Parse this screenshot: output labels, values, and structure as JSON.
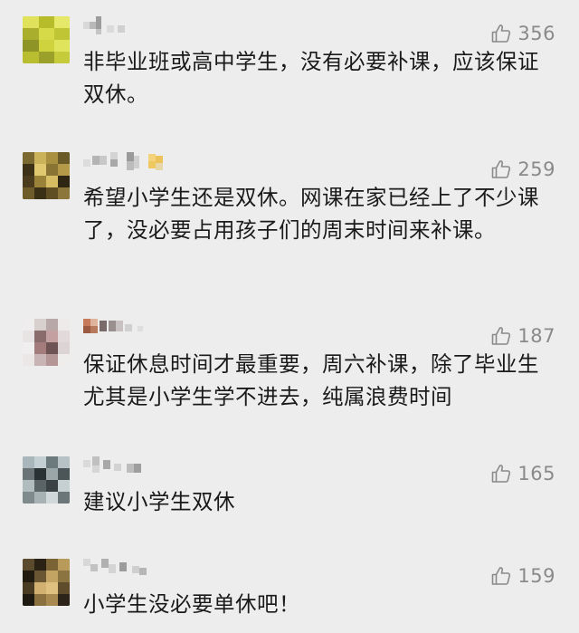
{
  "comments": [
    {
      "likes": "356",
      "text": "非毕业班或高中学生，没有必要补课，应该保证双休。"
    },
    {
      "likes": "259",
      "text": "希望小学生还是双休。网课在家已经上了不少课了，没必要占用孩子们的周末时间来补课。"
    },
    {
      "likes": "187",
      "text": "保证休息时间才最重要，周六补课，除了毕业生尤其是小学生学不进去，纯属浪费时间"
    },
    {
      "likes": "165",
      "text": "建议小学生双休"
    },
    {
      "likes": "159",
      "text": "小学生没必要单休吧！"
    }
  ],
  "icons": {
    "like": "thumbs-up-icon"
  },
  "colors": {
    "background": "#ededed",
    "text": "#1a1a1a",
    "like_count": "#8a8a8a"
  }
}
